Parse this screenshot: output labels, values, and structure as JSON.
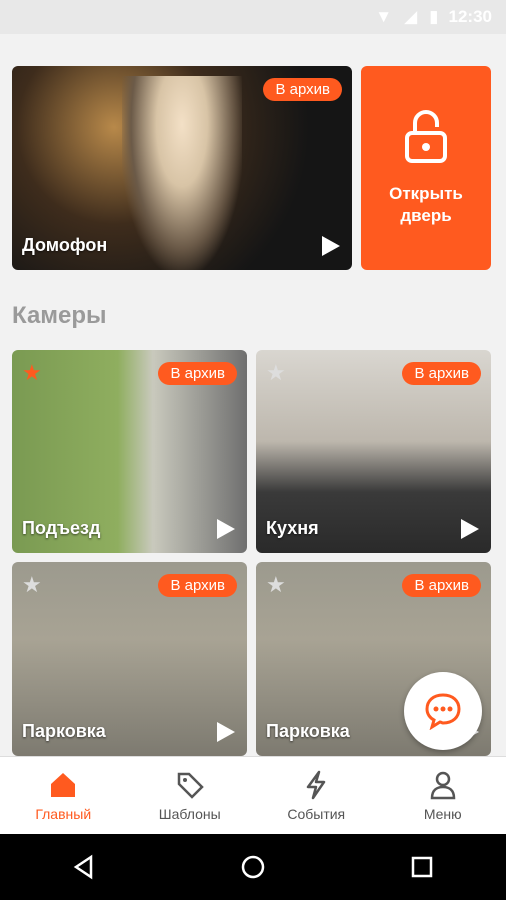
{
  "status_bar": {
    "time": "12:30"
  },
  "intercom": {
    "label": "Домофон",
    "archive_label": "В архив"
  },
  "open_door": {
    "label_line1": "Открыть",
    "label_line2": "дверь"
  },
  "section_title": "Камеры",
  "cameras": [
    {
      "label": "Подъезд",
      "archive_label": "В архив",
      "favorite": true
    },
    {
      "label": "Кухня",
      "archive_label": "В архив",
      "favorite": false
    },
    {
      "label": "Парковка",
      "archive_label": "В архив",
      "favorite": false
    },
    {
      "label": "Парковка",
      "archive_label": "В архив",
      "favorite": false
    }
  ],
  "bottom_nav": [
    {
      "label": "Главный",
      "icon": "home-icon",
      "active": true
    },
    {
      "label": "Шаблоны",
      "icon": "tag-icon",
      "active": false
    },
    {
      "label": "События",
      "icon": "lightning-icon",
      "active": false
    },
    {
      "label": "Меню",
      "icon": "user-icon",
      "active": false
    }
  ],
  "colors": {
    "accent": "#ff5a1f",
    "inactive": "#555555"
  }
}
